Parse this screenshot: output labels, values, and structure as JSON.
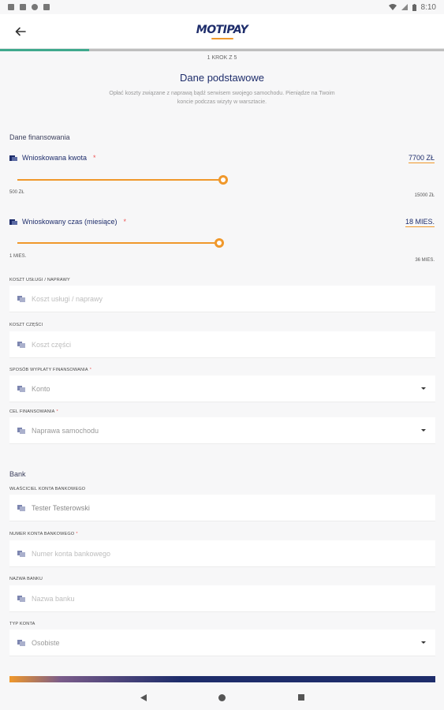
{
  "status_bar": {
    "time": "8:10"
  },
  "app_bar": {
    "logo_text": "MOTIPAY"
  },
  "progress": {
    "fraction": 0.2
  },
  "step_text": "1 KROK Z 5",
  "title": "Dane podstawowe",
  "subtitle": "Opłać koszty związane z naprawą bądź serwisem swojego samochodu. Pieniądze na Twoim koncie podczas wizyty w warsztacie.",
  "financing": {
    "section_title": "Dane finansowania",
    "amount": {
      "label": "Wnioskowana kwota",
      "required": "*",
      "value": "7700 ZŁ",
      "min_label": "500 ZŁ",
      "max_label": "15000 ZŁ",
      "fraction": 0.496
    },
    "duration": {
      "label": "Wnioskowany czas (miesiące)",
      "required": "*",
      "value": "18 MIES.",
      "min_label": "1 MIES.",
      "max_label": "36 MIES.",
      "fraction": 0.486
    },
    "fields": [
      {
        "label": "KOSZT USŁUGI / NAPRAWY",
        "required": "",
        "placeholder": "Koszt usługi / naprawy",
        "value": ""
      },
      {
        "label": "KOSZT CZĘŚCI",
        "required": "",
        "placeholder": "Koszt części",
        "value": ""
      }
    ],
    "payout_method": {
      "label": "SPOSÓB WYPŁATY FINANSOWANIA",
      "required": "*",
      "value": "Konto"
    },
    "financing_goal": {
      "label": "CEL FINANSOWANIA",
      "required": "*",
      "value": "Naprawa samochodu"
    }
  },
  "bank": {
    "section_title": "Bank",
    "owner": {
      "label": "WŁAŚCICIEL KONTA BANKOWEGO",
      "required": "",
      "placeholder": "",
      "value": "Tester Testerowski"
    },
    "account_number": {
      "label": "NUMER KONTA BANKOWEGO",
      "required": "*",
      "placeholder": "Numer konta bankowego",
      "value": ""
    },
    "bank_name": {
      "label": "NAZWA BANKU",
      "required": "",
      "placeholder": "Nazwa banku",
      "value": ""
    },
    "account_type": {
      "label": "TYP KONTA",
      "required": "",
      "value": "Osobiste"
    }
  },
  "colors": {
    "accent": "#f0982b",
    "brand": "#1e2d6b",
    "progress": "#3fa98d"
  },
  "icons": {
    "back": "arrow-left-icon",
    "field": "wallet-icon",
    "dropdown": "caret-down-icon"
  }
}
